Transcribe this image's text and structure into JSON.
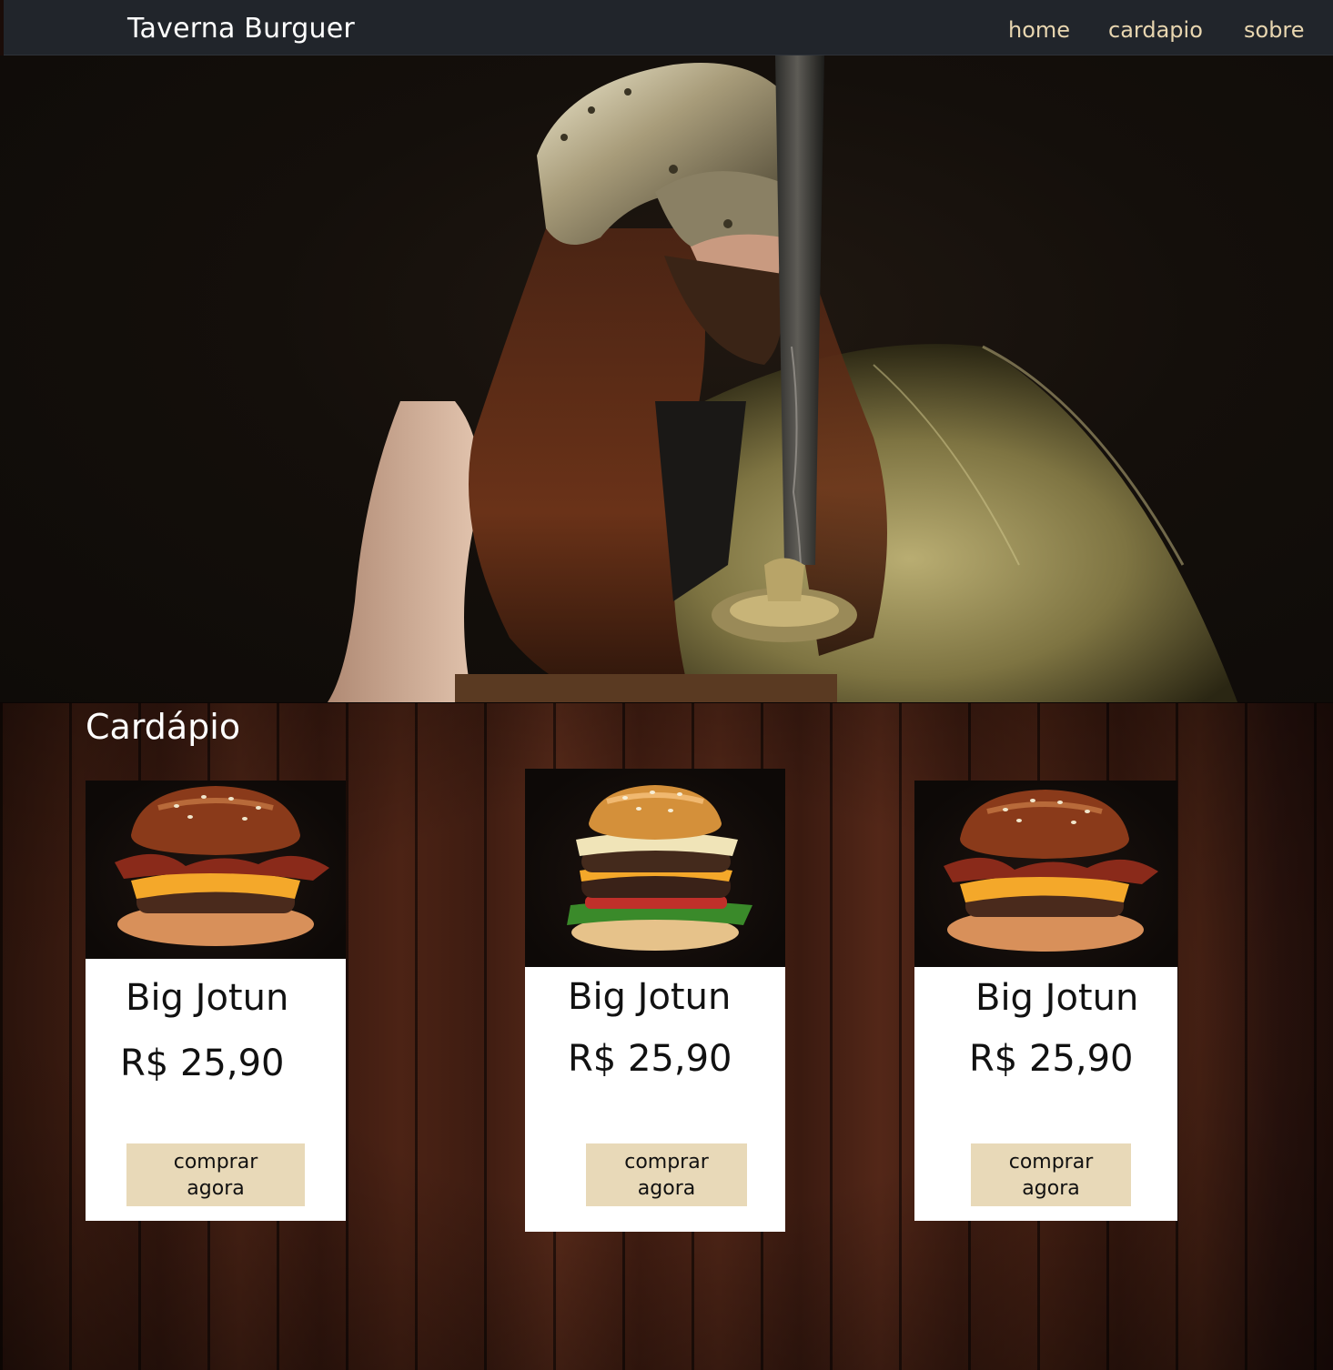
{
  "navbar": {
    "brand": "Taverna Burguer",
    "links": [
      {
        "label": "home"
      },
      {
        "label": "cardapio"
      },
      {
        "label": "sobre"
      }
    ]
  },
  "hero": {
    "image": "viking-warrior-with-sword"
  },
  "menu": {
    "title": "Cardápio",
    "items": [
      {
        "name": "Big Jotun",
        "price": "R$ 25,90",
        "button": "comprar agora",
        "image": "bacon-cheeseburger"
      },
      {
        "name": "Big Jotun",
        "price": "R$ 25,90",
        "button": "comprar agora",
        "image": "double-cheeseburger"
      },
      {
        "name": "Big Jotun",
        "price": "R$ 25,90",
        "button": "comprar agora",
        "image": "bacon-cheeseburger"
      }
    ]
  },
  "colors": {
    "navbar_bg": "#21252b",
    "nav_link": "#e8d6b0",
    "button_bg": "#e8d9b8",
    "wood": "#4a2214"
  }
}
